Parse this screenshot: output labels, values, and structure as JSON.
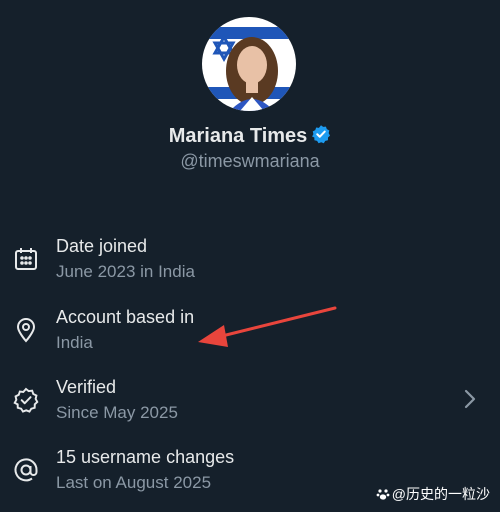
{
  "profile": {
    "name": "Mariana Times",
    "handle": "@timeswmariana",
    "verified_badge_color": "#1d9bf0"
  },
  "about": [
    {
      "icon": "calendar-icon",
      "title": "Date joined",
      "subtitle": "June 2023 in India",
      "has_chevron": false
    },
    {
      "icon": "location-pin-icon",
      "title": "Account based in",
      "subtitle": "India",
      "has_chevron": false
    },
    {
      "icon": "verified-outline-icon",
      "title": "Verified",
      "subtitle": "Since May 2025",
      "has_chevron": true
    },
    {
      "icon": "at-sign-icon",
      "title": "15 username changes",
      "subtitle": "Last on August 2025",
      "has_chevron": false
    }
  ],
  "annotation": {
    "arrow_color": "#e8453c",
    "points_to": "Account based in"
  },
  "watermark": {
    "text": "@历史的一粒沙"
  },
  "colors": {
    "background": "#15202b",
    "primary_text": "#e7e9ea",
    "secondary_text": "#8b98a5"
  }
}
